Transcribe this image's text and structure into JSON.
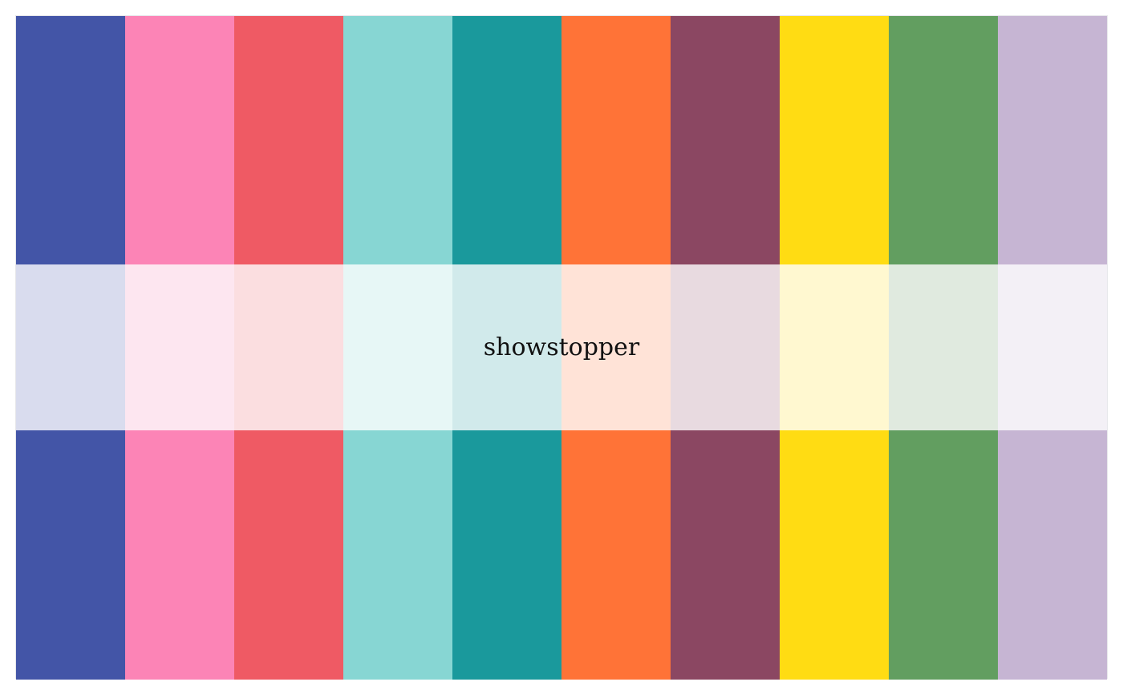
{
  "palette": {
    "name": "showstopper",
    "colors": [
      "#4355a7",
      "#fc84b6",
      "#ef5a64",
      "#87d6d3",
      "#1a999c",
      "#ff7337",
      "#8b4762",
      "#ffdc13",
      "#629e60",
      "#c6b5d3"
    ],
    "tints": [
      "#d9dcee",
      "#fde6f0",
      "#fbdee0",
      "#e7f7f6",
      "#d1eaeb",
      "#ffe3d7",
      "#e8dae0",
      "#fff8d0",
      "#e0eadf",
      "#f3f0f6"
    ]
  }
}
